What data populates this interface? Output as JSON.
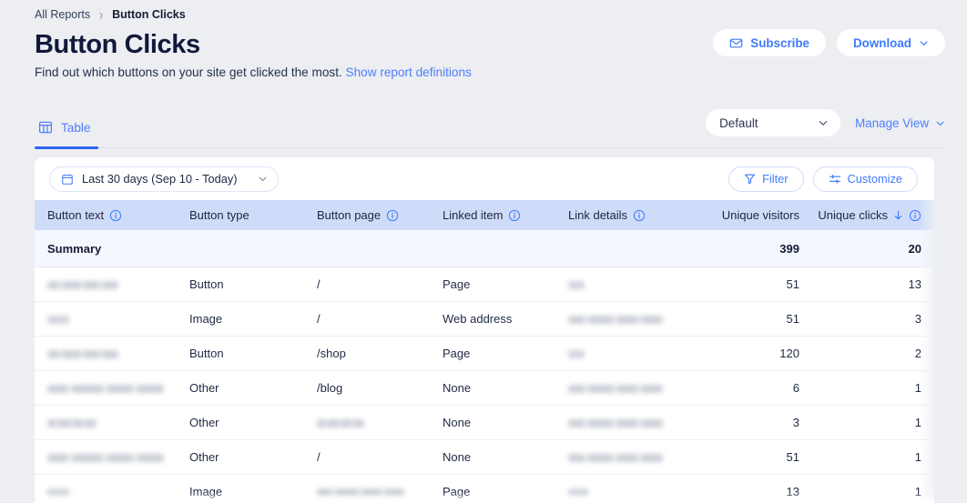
{
  "breadcrumb": {
    "parent": "All Reports",
    "separator": "›",
    "current": "Button Clicks"
  },
  "header": {
    "title": "Button Clicks",
    "subtitle": "Find out which buttons on your site get clicked the most.",
    "definitions_link": "Show report definitions",
    "subscribe_label": "Subscribe",
    "download_label": "Download"
  },
  "tabs": [
    {
      "label": "Table",
      "icon": "table-icon",
      "active": true
    }
  ],
  "view": {
    "selected": "Default",
    "manage_label": "Manage View"
  },
  "toolbar": {
    "date_range": "Last 30 days (Sep 10 - Today)",
    "filter_label": "Filter",
    "customize_label": "Customize"
  },
  "table": {
    "columns": [
      {
        "label": "Button text",
        "info": true,
        "align": "left",
        "sorted": false
      },
      {
        "label": "Button type",
        "info": false,
        "align": "left",
        "sorted": false
      },
      {
        "label": "Button page",
        "info": true,
        "align": "left",
        "sorted": false
      },
      {
        "label": "Linked item",
        "info": true,
        "align": "left",
        "sorted": false
      },
      {
        "label": "Link details",
        "info": true,
        "align": "left",
        "sorted": false
      },
      {
        "label": "Unique visitors",
        "info": false,
        "align": "right",
        "sorted": false
      },
      {
        "label": "Unique clicks",
        "info": true,
        "align": "right",
        "sorted": true,
        "sort_direction": "desc"
      }
    ],
    "summary": {
      "label": "Summary",
      "unique_visitors": "399",
      "unique_clicks": "20"
    },
    "rows": [
      {
        "button_text": "",
        "button_text_redacted": 78,
        "button_type": "Button",
        "button_page": "/",
        "button_page_redacted": 0,
        "linked_item": "Page",
        "link_details": "",
        "link_details_redacted": 18,
        "unique_visitors": "51",
        "unique_clicks": "13"
      },
      {
        "button_text": "",
        "button_text_redacted": 24,
        "button_type": "Image",
        "button_page": "/",
        "button_page_redacted": 0,
        "linked_item": "Web address",
        "link_details": "",
        "link_details_redacted": 104,
        "unique_visitors": "51",
        "unique_clicks": "3"
      },
      {
        "button_text": "",
        "button_text_redacted": 78,
        "button_type": "Button",
        "button_page": "/shop",
        "button_page_redacted": 0,
        "linked_item": "Page",
        "link_details": "",
        "link_details_redacted": 18,
        "unique_visitors": "120",
        "unique_clicks": "2"
      },
      {
        "button_text": "",
        "button_text_redacted": 128,
        "button_type": "Other",
        "button_page": "/blog",
        "button_page_redacted": 0,
        "linked_item": "None",
        "link_details": "",
        "link_details_redacted": 104,
        "unique_visitors": "6",
        "unique_clicks": "1"
      },
      {
        "button_text": "",
        "button_text_redacted": 54,
        "button_type": "Other",
        "button_page": "",
        "button_page_redacted": 52,
        "linked_item": "None",
        "link_details": "",
        "link_details_redacted": 104,
        "unique_visitors": "3",
        "unique_clicks": "1"
      },
      {
        "button_text": "",
        "button_text_redacted": 128,
        "button_type": "Other",
        "button_page": "/",
        "button_page_redacted": 0,
        "linked_item": "None",
        "link_details": "",
        "link_details_redacted": 104,
        "unique_visitors": "51",
        "unique_clicks": "1"
      },
      {
        "button_text": "",
        "button_text_redacted": 24,
        "button_type": "Image",
        "button_page": "",
        "button_page_redacted": 96,
        "linked_item": "Page",
        "link_details": "",
        "link_details_redacted": 22,
        "unique_visitors": "13",
        "unique_clicks": "1"
      }
    ]
  },
  "colors": {
    "accent": "#4d7efc",
    "header_band": "#cfdcf9",
    "summary_row": "#f4f7fe",
    "page_bg": "#edeef2",
    "title": "#10193a"
  }
}
